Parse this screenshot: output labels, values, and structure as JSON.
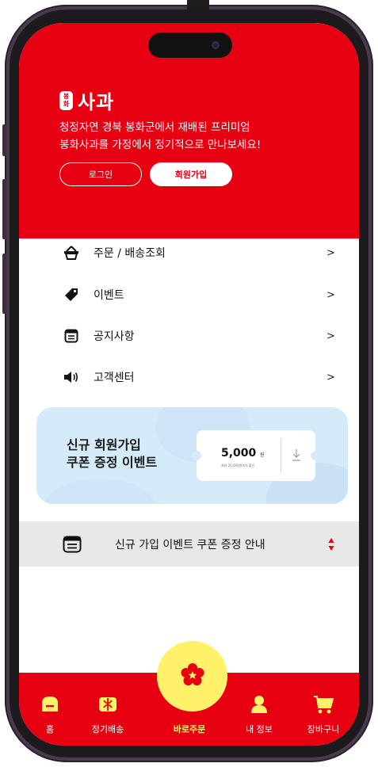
{
  "colors": {
    "brand_red": "#e60012",
    "accent_yellow": "#fff16a",
    "banner_blue": "#d6ebfa",
    "notice_gray": "#e8e8e8"
  },
  "header": {
    "logo_badge": [
      "봉",
      "화"
    ],
    "logo_text": "사과",
    "description": "청정자연 경북 봉화군에서 재배된 프리미엄\n봉화사과를 가정에서 정기적으로 만나보세요!",
    "login_label": "로그인",
    "join_label": "회원가입"
  },
  "menu": {
    "items": [
      {
        "icon": "basket-icon",
        "label": "주문 / 배송조회",
        "arrow": ">"
      },
      {
        "icon": "tag-icon",
        "label": "이벤트",
        "arrow": ">"
      },
      {
        "icon": "notice-icon",
        "label": "공지사항",
        "arrow": ">"
      },
      {
        "icon": "speaker-icon",
        "label": "고객센터",
        "arrow": ">"
      }
    ]
  },
  "banner": {
    "title": "신규 회원가입\n쿠폰 증정 이벤트",
    "coupon_amount": "5,000",
    "coupon_unit": "원",
    "coupon_note": "최대 20,000원까지 할인",
    "download_icon": "download-icon"
  },
  "notice_bar": {
    "icon": "list-icon",
    "text": "신규 가입 이벤트 쿠폰 증정 안내",
    "toggle_icon": "up-down-icon"
  },
  "tabbar": {
    "tabs": [
      {
        "icon": "home-icon",
        "label": "홈"
      },
      {
        "icon": "gift-icon",
        "label": "정기배송"
      },
      {
        "icon": "apple-flower-icon",
        "label": "바로주문"
      },
      {
        "icon": "user-icon",
        "label": "내 정보"
      },
      {
        "icon": "cart-icon",
        "label": "장바구니"
      }
    ]
  }
}
